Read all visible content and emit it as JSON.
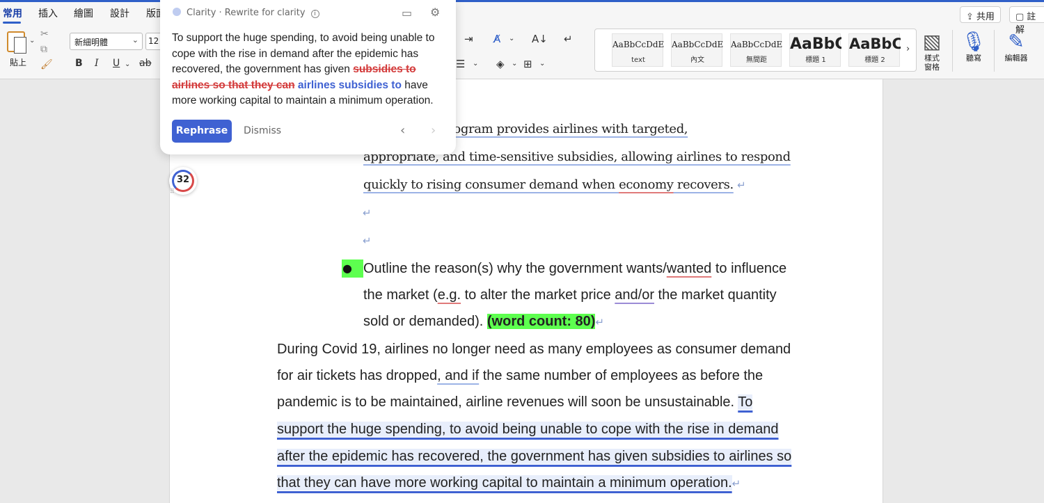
{
  "ribbon": {
    "tabs": [
      "常用",
      "插入",
      "繪圖",
      "設計",
      "版面"
    ],
    "share_label": "共用",
    "comments_label": "註解",
    "paste_label": "貼上",
    "font_name": "新細明體",
    "font_size": "12",
    "format_buttons": [
      "B",
      "I",
      "U",
      "ab"
    ],
    "styles": [
      {
        "preview": "AaBbCcDdEe",
        "name": "text"
      },
      {
        "preview": "AaBbCcDdEe",
        "name": "內文"
      },
      {
        "preview": "AaBbCcDdEe",
        "name": "無間距"
      },
      {
        "preview": "AaBbC(",
        "name": "標題 1"
      },
      {
        "preview": "AaBbC",
        "name": "標題 2"
      }
    ],
    "styles_pane_label": [
      "樣式",
      "窗格"
    ],
    "dictate_label": "聽寫",
    "editor_label": "編輯器"
  },
  "document": {
    "line1_a": "y, the RDAC program provides airlines with targeted,",
    "line2": "appropriate, and time-sensitive subsidies, allowing airlines to respond",
    "line3_a": "quickly to rising consumer demand when ",
    "line3_b": "economy",
    "line3_c": " recovers.",
    "bullet_l1_a": "Outline the reason(s) why the government wants/",
    "bullet_l1_b": "wanted",
    "bullet_l1_c": " to influence",
    "bullet_l2_a": "the market (",
    "bullet_l2_b": "e.g.",
    "bullet_l2_c": " to alter the market price ",
    "bullet_l2_d": "and/or",
    "bullet_l2_e": " the market quantity",
    "bullet_l3_a": "sold or demanded). ",
    "word_count": "(word count: 80)",
    "p1": "During Covid 19, airlines no longer need as many employees as consumer demand",
    "p2_a": "for air tickets has dropped",
    "p2_b": ", and if",
    "p2_c": " the same number of employees as before the",
    "p3_a": "pandemic is to be maintained, airline revenues will soon be unsustainable. ",
    "p3_b": "To",
    "p4": "support the huge spending, to avoid being unable to cope with the rise in demand",
    "p5": "after the epidemic has recovered, the government has given subsidies to airlines so",
    "p6": "that they can have more working capital to maintain a minimum operation."
  },
  "clarity": {
    "header": "Clarity · Rewrite for clarity",
    "body_plain": "To support the huge spending, to avoid being unable to cope with the rise in demand after the epidemic has recovered, the government has given ",
    "body_deleted": "subsidies to airlines so that they can",
    "body_inserted": "airlines subsidies to",
    "body_end": " have more working capital to maintain a minimum operation.",
    "rephrase_label": "Rephrase",
    "dismiss_label": "Dismiss",
    "badge_count": "32"
  },
  "colors": {
    "accent": "#3f61d2",
    "deleted": "#d33a3a",
    "highlight_green": "#5dff4f"
  }
}
